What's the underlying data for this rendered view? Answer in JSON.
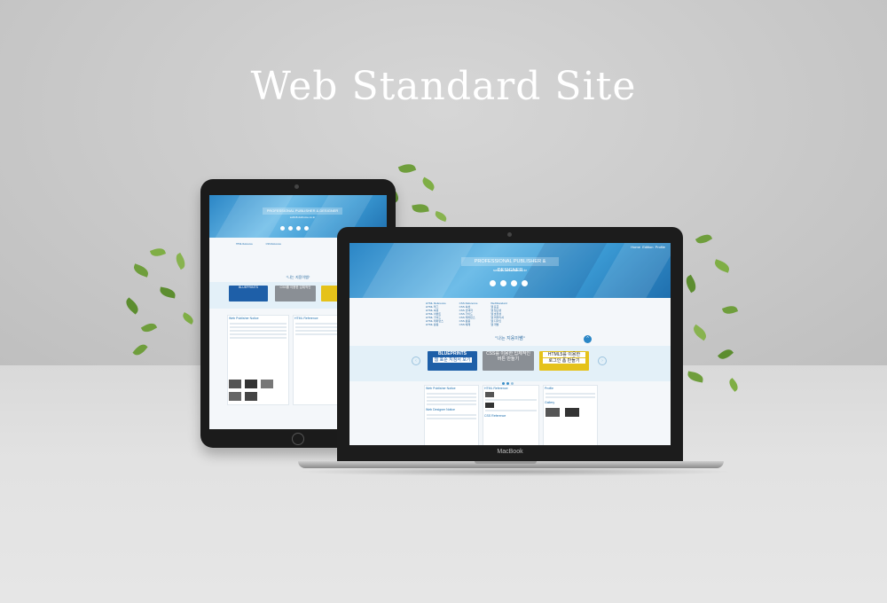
{
  "headline": "Web Standard Site",
  "device_brand": "MacBook",
  "site": {
    "nav": [
      "Home",
      "Edition",
      "Profile"
    ],
    "banner": "PROFESSIONAL PUBLISHER & DESIGNER",
    "subtitle": "sw918.dothome.co.kr",
    "columns": [
      {
        "title": "HTML Reference",
        "items": [
          "HTML 태그",
          "HTML 속성",
          "HTML 이벤트",
          "HTML 가이드",
          "HTML 레퍼런스",
          "HTML 활용"
        ]
      },
      {
        "title": "CSS Reference",
        "items": [
          "CSS 속성",
          "CSS 선택자",
          "CSS 가이드",
          "CSS 레퍼런스",
          "CSS 활용",
          "CSS 예제"
        ]
      },
      {
        "title": "WebStandard",
        "items": [
          "웹 표준",
          "웹 접근성",
          "웹 호환성",
          "웹 퍼블리셔",
          "웹 디자인",
          "웹 개발"
        ]
      }
    ],
    "quote": "\"나는 지웅이쌤\"",
    "slides": [
      {
        "title": "BLUEPRINTS",
        "caption": "웹 표준 지침서 보기"
      },
      {
        "title": "CSS를 이용한 입체적인",
        "caption": "버튼 만들기"
      },
      {
        "title": "HTML5를 이용한",
        "caption": "로그인 폼 만들기"
      }
    ],
    "sections": [
      "Web Publisher Notice",
      "HTML Reference",
      "Gallery",
      "Web Designer Notice",
      "CSS Reference",
      "Profile"
    ]
  },
  "colors": {
    "accent": "#2a86c6",
    "hero_light": "#6fbde8",
    "hero_dark": "#1f6fae",
    "slide_blue": "#1e5fa8",
    "slide_yellow": "#e5c21a",
    "leaf": "#6f9e3c"
  },
  "icons": [
    "play-icon",
    "heart-icon",
    "settings-icon",
    "chat-icon",
    "chevron-up-icon",
    "arrow-left-icon",
    "arrow-right-icon"
  ]
}
